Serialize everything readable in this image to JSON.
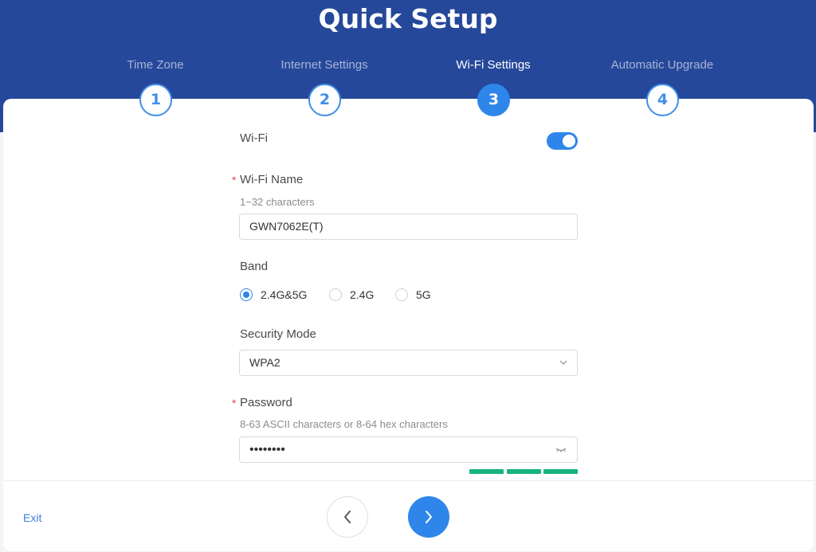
{
  "page": {
    "title": "Quick Setup"
  },
  "steps": [
    {
      "number": "1",
      "label": "Time Zone",
      "active": false
    },
    {
      "number": "2",
      "label": "Internet Settings",
      "active": false
    },
    {
      "number": "3",
      "label": "Wi-Fi Settings",
      "active": true
    },
    {
      "number": "4",
      "label": "Automatic Upgrade",
      "active": false
    }
  ],
  "form": {
    "wifi": {
      "label": "Wi-Fi",
      "enabled": true
    },
    "wifi_name": {
      "required_mark": "*",
      "label": "Wi-Fi Name",
      "hint": "1~32 characters",
      "value": "GWN7062E(T)"
    },
    "band": {
      "label": "Band",
      "options": [
        {
          "label": "2.4G&5G",
          "checked": true
        },
        {
          "label": "2.4G",
          "checked": false
        },
        {
          "label": "5G",
          "checked": false
        }
      ]
    },
    "security_mode": {
      "label": "Security Mode",
      "value": "WPA2"
    },
    "password": {
      "required_mark": "*",
      "label": "Password",
      "hint": "8-63 ASCII characters or 8-64 hex characters",
      "value": "••••••••",
      "strength_segments_filled": 3,
      "strength_color": "#16b57d"
    }
  },
  "footer": {
    "exit_label": "Exit"
  },
  "colors": {
    "header": "#26489a",
    "accent": "#2f86ea"
  }
}
